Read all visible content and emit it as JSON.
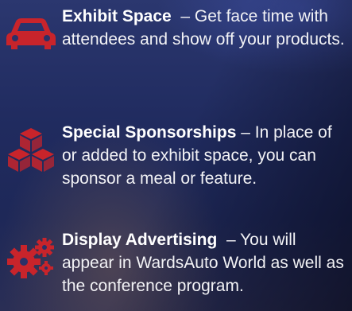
{
  "colors": {
    "icon_red": "#c8242b",
    "text": "#f2f2f5",
    "background": "#222a55"
  },
  "items": [
    {
      "icon": "car-icon",
      "title": "Exhibit Space",
      "description": "  – Get face time with attendees and show off your products."
    },
    {
      "icon": "cubes-icon",
      "title": "Special Sponsorships",
      "description": " – In place of or added to exhibit space, you can sponsor a meal or feature."
    },
    {
      "icon": "gears-icon",
      "title": "Display Advertising",
      "description": "  – You will appear in WardsAuto World as well as the conference program."
    }
  ]
}
